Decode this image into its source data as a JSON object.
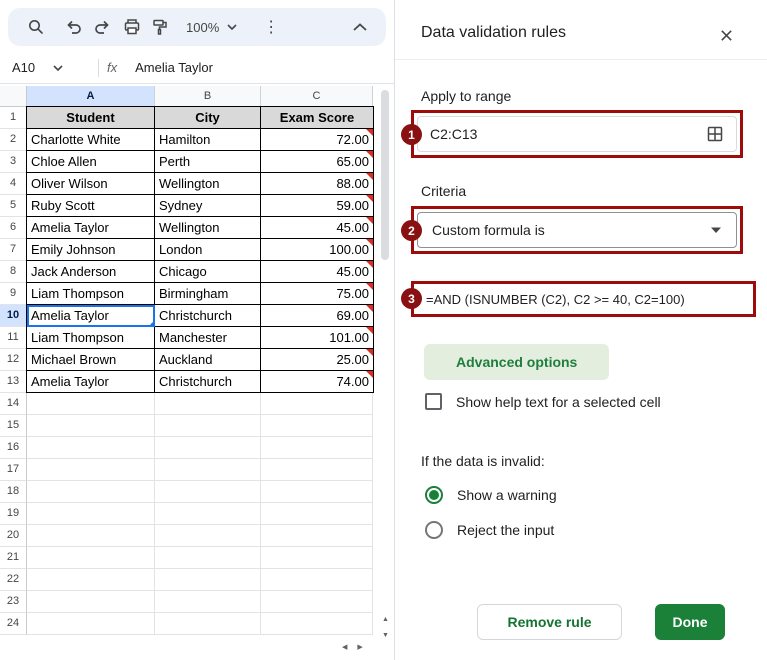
{
  "toolbar": {
    "zoom_label": "100%"
  },
  "formula_bar": {
    "cell_ref": "A10",
    "fx_label": "fx",
    "value": "Amelia Taylor"
  },
  "sheet": {
    "column_letters": [
      "A",
      "B",
      "C"
    ],
    "total_rows": 24,
    "header_row": [
      "Student",
      "City",
      "Exam Score"
    ],
    "data_rows": [
      [
        "Charlotte White",
        "Hamilton",
        "72.00"
      ],
      [
        "Chloe Allen",
        "Perth",
        "65.00"
      ],
      [
        "Oliver Wilson",
        "Wellington",
        "88.00"
      ],
      [
        "Ruby Scott",
        "Sydney",
        "59.00"
      ],
      [
        "Amelia Taylor",
        "Wellington",
        "45.00"
      ],
      [
        "Emily Johnson",
        "London",
        "100.00"
      ],
      [
        "Jack Anderson",
        "Chicago",
        "45.00"
      ],
      [
        "Liam Thompson",
        "Birmingham",
        "75.00"
      ],
      [
        "Amelia Taylor",
        "Christchurch",
        "69.00"
      ],
      [
        "Liam Thompson",
        "Manchester",
        "101.00"
      ],
      [
        "Michael Brown",
        "Auckland",
        "25.00"
      ],
      [
        "Amelia Taylor",
        "Christchurch",
        "74.00"
      ]
    ],
    "selected_cell": {
      "column": "A",
      "row": 10,
      "value": "Amelia Taylor"
    },
    "flagged_range": "C2:C13"
  },
  "panel": {
    "title": "Data validation rules",
    "apply_to_range_label": "Apply to range",
    "range_value": "C2:C13",
    "criteria_label": "Criteria",
    "criteria_selected": "Custom formula is",
    "formula_value": "=AND (ISNUMBER (C2), C2 >= 40, C2=100)",
    "advanced_options_label": "Advanced options",
    "help_text_label": "Show help text for a selected cell",
    "help_text_checked": false,
    "invalid_heading": "If the data is invalid:",
    "invalid_options": [
      {
        "label": "Show a warning",
        "selected": true
      },
      {
        "label": "Reject the input",
        "selected": false
      }
    ],
    "remove_rule_label": "Remove rule",
    "done_label": "Done"
  },
  "annotations": {
    "steps": [
      "1",
      "2",
      "3"
    ]
  },
  "colors": {
    "annotation_red": "#9e0b0b",
    "badge_red": "#8a1111",
    "invalid_flag_red": "#e02b20",
    "selection_blue": "#1a73e8",
    "active_header_blue": "#d3e3fd",
    "table_header_gray": "#d9d9d9",
    "green": "#188038",
    "advanced_button_bg": "#e4eedf",
    "toolbar_bg": "#edf2fa"
  }
}
